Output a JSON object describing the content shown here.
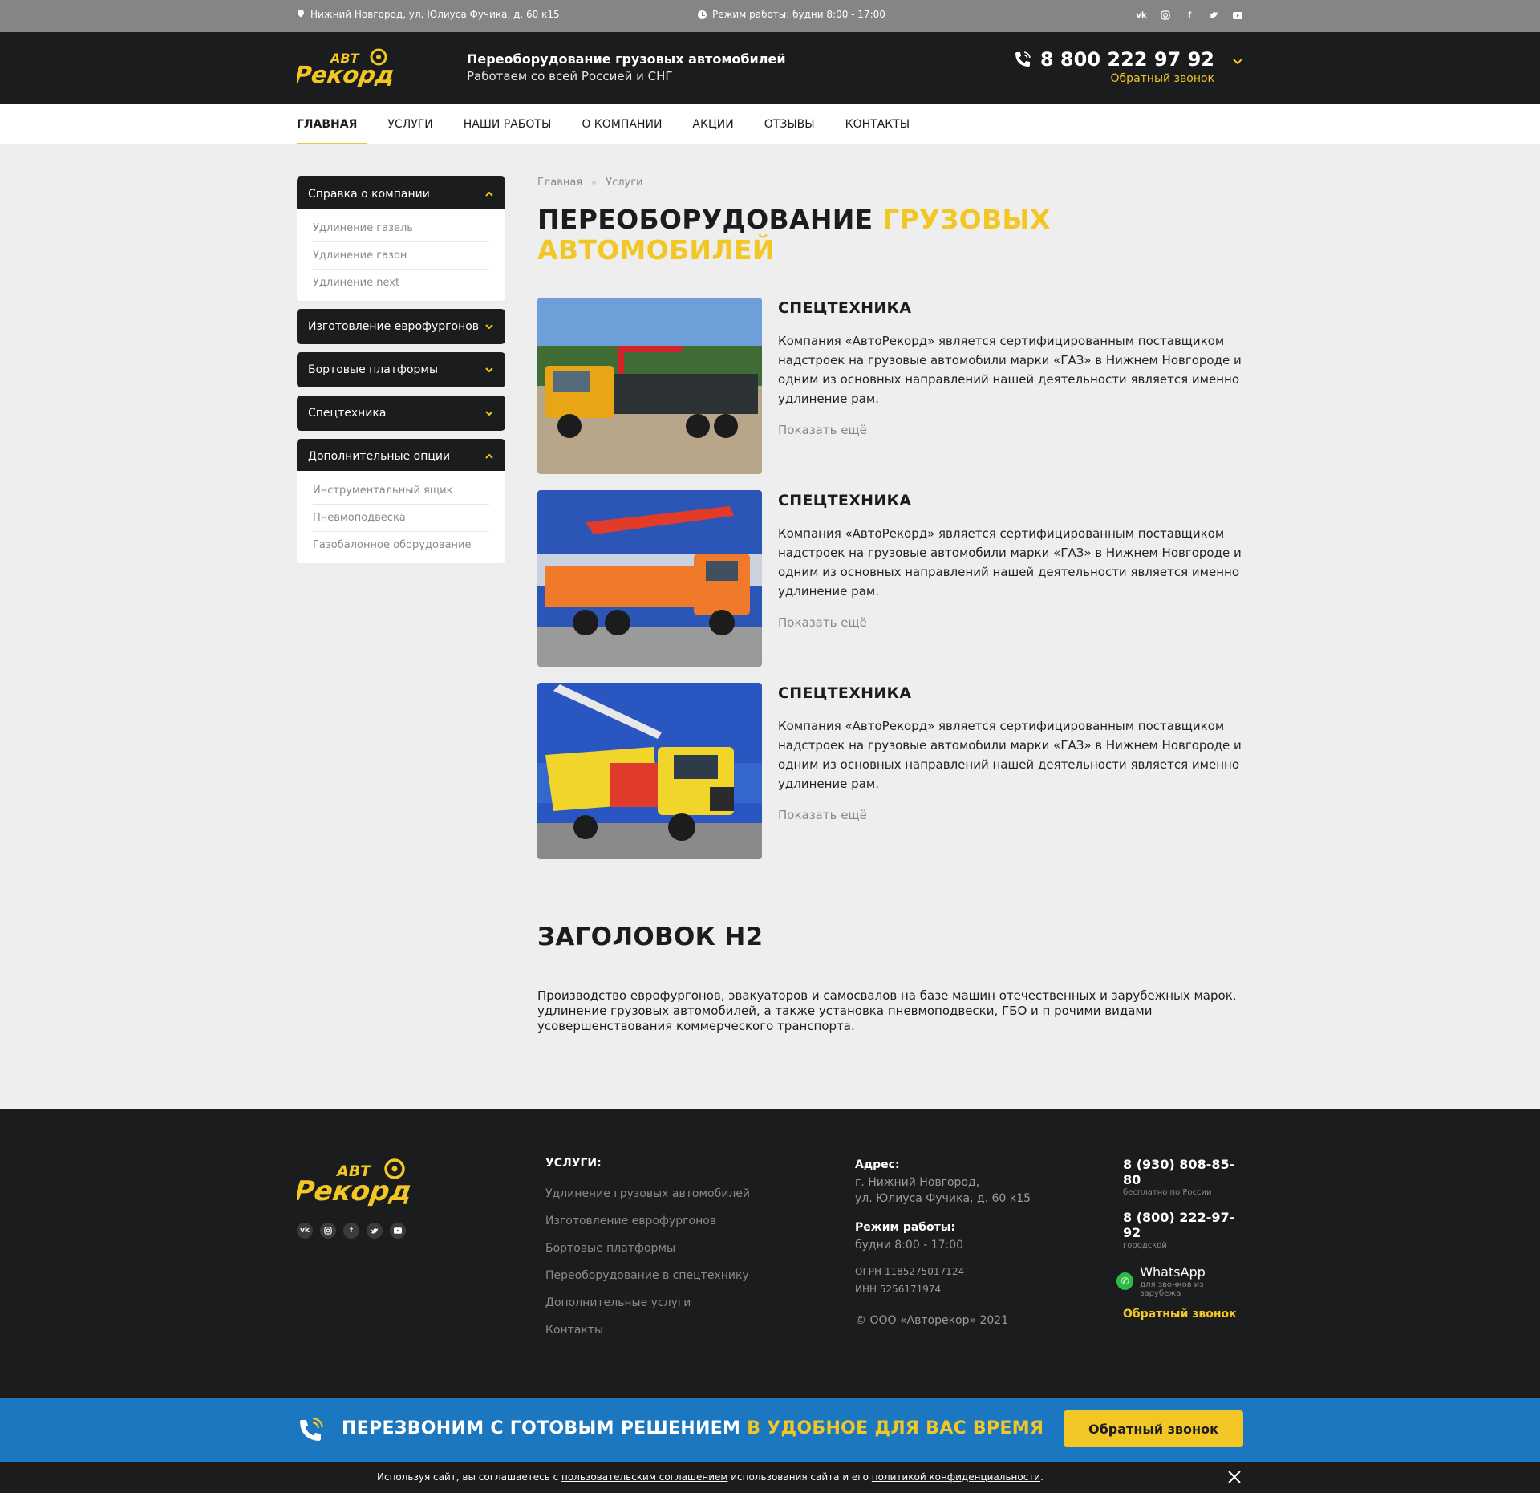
{
  "topbar": {
    "address": "Нижний Новгород, ул. Юлиуса Фучика, д. 60 к15",
    "hours": "Режим работы: будни 8:00 - 17:00",
    "social": [
      "vk",
      "instagram",
      "facebook",
      "twitter",
      "youtube"
    ]
  },
  "header": {
    "tagline_1": "Переоборудование грузовых автомобилей",
    "tagline_2": "Работаем со всей Россией и СНГ",
    "phone": "8 800 222 97 92",
    "callback": "Обратный звонок"
  },
  "nav": [
    "ГЛАВНАЯ",
    "УСЛУГИ",
    "НАШИ РАБОТЫ",
    "О КОМПАНИИ",
    "АКЦИИ",
    "ОТЗЫВЫ",
    "КОНТАКТЫ"
  ],
  "sidebar": [
    {
      "title": "Справка о компании",
      "open": true,
      "items": [
        "Удлинение газель",
        "Удлинение газон",
        "Удлинение next"
      ]
    },
    {
      "title": "Изготовление еврофургонов",
      "open": false,
      "items": []
    },
    {
      "title": "Бортовые платформы",
      "open": false,
      "items": []
    },
    {
      "title": "Спецтехника",
      "open": false,
      "items": []
    },
    {
      "title": "Дополнительные опции",
      "open": true,
      "items": [
        "Инструментальный ящик",
        "Пневмоподвеска",
        "Газобалонное оборудование"
      ]
    }
  ],
  "breadcrumbs": [
    "Главная",
    "Услуги"
  ],
  "page_title": {
    "part1": "ПЕРЕОБОРУДОВАНИЕ",
    "part2": "ГРУЗОВЫХ",
    "part3": "АВТОМОБИЛЕЙ"
  },
  "cards": [
    {
      "title": "СПЕЦТЕХНИКА",
      "text": "Компания «АвтоРекорд» является сертифицированным поставщиком надстроек на грузовые автомобили марки «ГАЗ» в Нижнем Новгороде и одним из основных направлений нашей деятельности является именно удлинение рам.",
      "more": "Показать ещё",
      "truck_color": "#e8a516"
    },
    {
      "title": "СПЕЦТЕХНИКА",
      "text": "Компания «АвтоРекорд» является сертифицированным поставщиком надстроек на грузовые автомобили марки «ГАЗ» в Нижнем Новгороде и одним из основных направлений нашей деятельности является именно удлинение рам.",
      "more": "Показать ещё",
      "truck_color": "#f07a2a"
    },
    {
      "title": "СПЕЦТЕХНИКА",
      "text": "Компания «АвтоРекорд» является сертифицированным поставщиком надстроек на грузовые автомобили марки «ГАЗ» в Нижнем Новгороде и одним из основных направлений нашей деятельности является именно удлинение рам.",
      "more": "Показать ещё",
      "truck_color": "#f2d52a"
    }
  ],
  "h2": "ЗАГОЛОВОК H2",
  "seo_text": "Производство еврофургонов, эвакуаторов и самосвалов на базе машин отечественных и зарубежных марок, удлинение грузовых автомобилей, а также установка пневмоподвески, ГБО и п рочими видами усовершенствования коммерческого транспорта.",
  "footer": {
    "services_title": "УСЛУГИ:",
    "services": [
      "Удлинение грузовых автомобилей",
      "Изготовление еврофургонов",
      "Бортовые платформы",
      "Переоборудование в спецтехнику",
      "Дополнительные услуги",
      "Контакты"
    ],
    "address_label": "Адрес:",
    "address_1": "г. Нижний Новгород,",
    "address_2": "ул. Юлиуса Фучика, д. 60 к15",
    "hours_label": "Режим работы:",
    "hours": "будни  8:00 - 17:00",
    "ogrn": "ОГРН 1185275017124",
    "inn": "ИНН 5256171974",
    "copyright": "© ООО «Авторекор» 2021",
    "phone1": "8 (930) 808-85-80",
    "phone1_note": "бесплатно по России",
    "phone2": "8 (800) 222-97-92",
    "phone2_note": "городской",
    "whatsapp": "WhatsApp",
    "whatsapp_note": "для звонков из зарубежа",
    "callback": "Обратный звонок"
  },
  "callback_bar": {
    "text_white": "ПЕРЕЗВОНИМ С ГОТОВЫМ РЕШЕНИЕМ",
    "text_yellow": "В УДОБНОЕ ДЛЯ ВАС ВРЕМЯ",
    "button": "Обратный звонок"
  },
  "cookie": {
    "t1": "Используя  сайт, вы соглашаетесь с ",
    "link1": "пользовательским соглашением",
    "t2": "  использования сайта и его  ",
    "link2": "политикой конфиденциальности",
    "t3": "."
  },
  "colors": {
    "accent": "#f2c725",
    "dark": "#1b1c1e",
    "blue": "#1b77c0"
  }
}
